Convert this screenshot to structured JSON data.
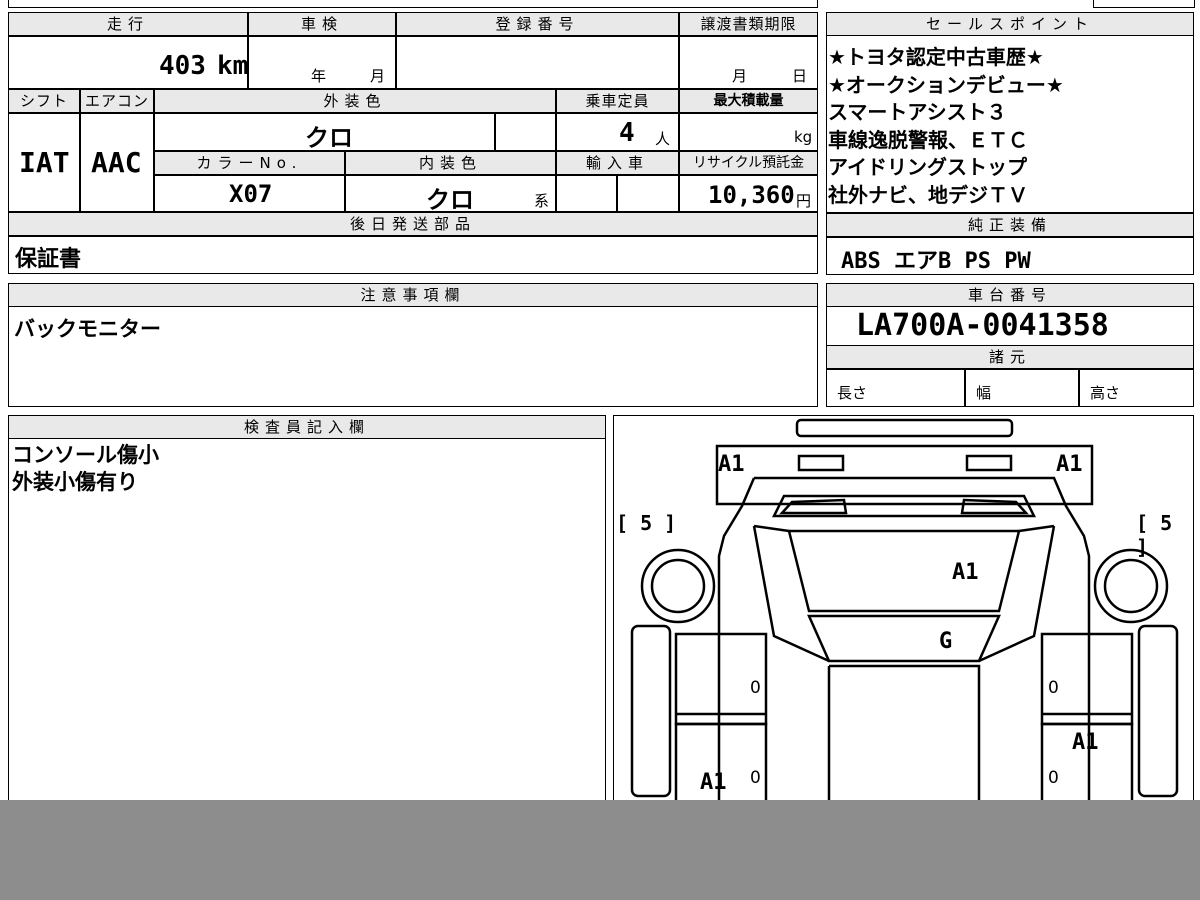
{
  "mileage": {
    "header": "走行",
    "value": "403",
    "unit": "km"
  },
  "inspection": {
    "header": "車検",
    "year_label": "年",
    "month_label": "月"
  },
  "registration": {
    "header": "登録番号"
  },
  "transfer_deadline": {
    "header": "譲渡書類期限",
    "month_label": "月",
    "day_label": "日"
  },
  "shift": {
    "header": "シフト",
    "value": "IAT"
  },
  "aircon": {
    "header": "エアコン",
    "value": "AAC"
  },
  "exterior_color": {
    "header": "外装色",
    "value": "クロ"
  },
  "capacity": {
    "header": "乗車定員",
    "value": "4",
    "unit": "人"
  },
  "max_load": {
    "header": "最大積載量",
    "unit": "kg"
  },
  "color_no": {
    "header": "カラーNo.",
    "value": "X07"
  },
  "interior_color": {
    "header": "内装色",
    "value": "クロ",
    "suffix": "系"
  },
  "import": {
    "header": "輸入車"
  },
  "recycle": {
    "header": "リサイクル預託金",
    "value": "10,360",
    "unit": "円"
  },
  "later_parts": {
    "header": "後日発送部品",
    "value": "保証書"
  },
  "sales_points": {
    "header": "セールスポイント",
    "lines": [
      "★トヨタ認定中古車歴★",
      "★オークションデビュー★",
      "スマートアシスト３",
      "車線逸脱警報、ＥＴＣ",
      "アイドリングストップ",
      "社外ナビ、地デジＴＶ"
    ]
  },
  "genuine_equipment": {
    "header": "純正装備",
    "value": "ABS エアB PS PW"
  },
  "notes": {
    "header": "注意事項欄",
    "value": "バックモニター"
  },
  "chassis_number": {
    "header": "車台番号",
    "value": "LA700A-0041358"
  },
  "specs": {
    "header": "諸元",
    "length_label": "長さ",
    "width_label": "幅",
    "height_label": "高さ"
  },
  "inspector_notes": {
    "header": "検査員記入欄",
    "lines": [
      "コンソール傷小",
      "外装小傷有り"
    ]
  },
  "diagram": {
    "marks": {
      "front_left": "A1",
      "front_right": "A1",
      "left_bracket": "[ 5 ]",
      "right_bracket": "[ 5 ]",
      "hood": "A1",
      "windshield": "G",
      "door_fl": "0",
      "door_fr": "0",
      "door_rl": "0",
      "door_rr": "0",
      "rear_left": "A1",
      "rear_right": "A1"
    }
  }
}
